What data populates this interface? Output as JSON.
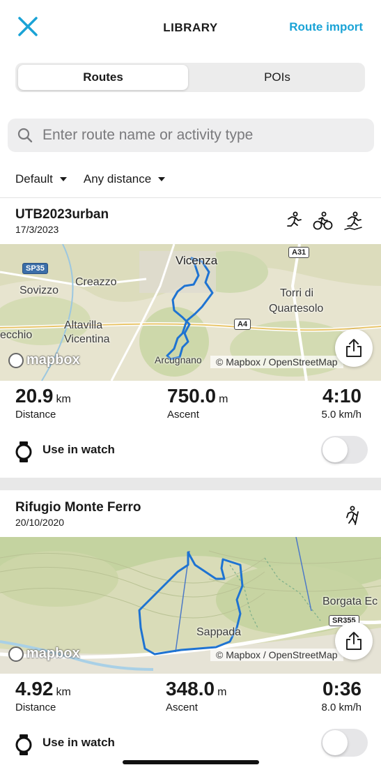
{
  "header": {
    "title": "LIBRARY",
    "action_label": "Route import",
    "close_icon": "close-icon",
    "accent_color": "#1aa3d6"
  },
  "tabs": [
    {
      "label": "Routes",
      "active": true
    },
    {
      "label": "POIs",
      "active": false
    }
  ],
  "search": {
    "placeholder": "Enter route name or activity type",
    "value": ""
  },
  "filters": [
    {
      "label": "Default"
    },
    {
      "label": "Any distance"
    }
  ],
  "routes": [
    {
      "name": "UTB2023urban",
      "date": "17/3/2023",
      "activity_icons": [
        "running-icon",
        "cycling-icon",
        "trail-running-icon"
      ],
      "map": {
        "labels": [
          "Vicenza",
          "Creazzo",
          "Sovizzo",
          "Torri di",
          "Quartesolo",
          "Altavilla",
          "Vicentina",
          "ecchio",
          "Arcugnano"
        ],
        "road_shields": [
          "SP35",
          "A31",
          "A4"
        ],
        "logo": "mapbox",
        "attribution": "© Mapbox / OpenStreetMap"
      },
      "stats": {
        "distance": {
          "value": "20.9",
          "unit": "km",
          "label": "Distance"
        },
        "ascent": {
          "value": "750.0",
          "unit": "m",
          "label": "Ascent"
        },
        "duration": {
          "value": "4:10",
          "sub": "5.0 km/h"
        }
      },
      "watch": {
        "label": "Use in watch",
        "enabled": false
      }
    },
    {
      "name": "Rifugio Monte Ferro",
      "date": "20/10/2020",
      "activity_icons": [
        "hiking-icon"
      ],
      "map": {
        "labels": [
          "Sappada",
          "Borgata Ec"
        ],
        "road_shields": [
          "SR355"
        ],
        "logo": "mapbox",
        "attribution": "© Mapbox / OpenStreetMap"
      },
      "stats": {
        "distance": {
          "value": "4.92",
          "unit": "km",
          "label": "Distance"
        },
        "ascent": {
          "value": "348.0",
          "unit": "m",
          "label": "Ascent"
        },
        "duration": {
          "value": "0:36",
          "sub": "8.0 km/h"
        }
      },
      "watch": {
        "label": "Use in watch",
        "enabled": false
      }
    }
  ]
}
